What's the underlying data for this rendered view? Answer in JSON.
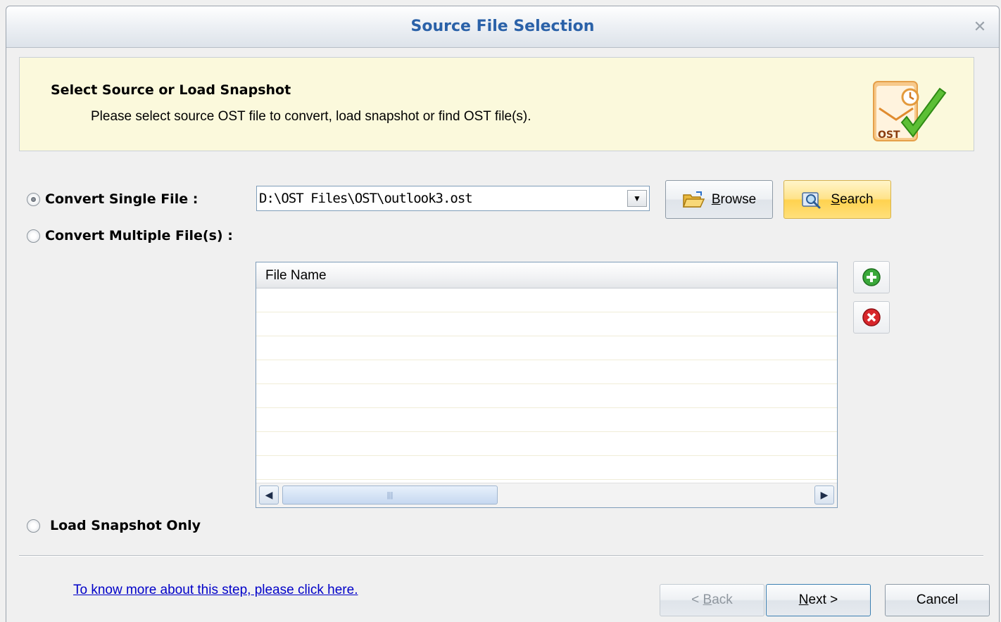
{
  "window": {
    "title": "Source File Selection",
    "close_glyph": "✕"
  },
  "info": {
    "heading": "Select Source or Load Snapshot",
    "description": "Please select source OST file to convert, load snapshot or find OST file(s).",
    "logo_text": "OST"
  },
  "options": {
    "single": {
      "label": "Convert Single File :",
      "checked": true
    },
    "multiple": {
      "label": "Convert Multiple File(s) :",
      "checked": false
    },
    "snapshot": {
      "label": "Load Snapshot Only",
      "checked": false
    }
  },
  "single_file": {
    "path": "D:\\OST Files\\OST\\outlook3.ost",
    "browse": {
      "access_key": "B",
      "rest": "rowse"
    },
    "search": {
      "access_key": "S",
      "rest": "earch"
    }
  },
  "file_list": {
    "column_header": "File Name",
    "rows": []
  },
  "help_link": "To know more about this step, please click here.",
  "footer": {
    "back": {
      "prefix": "< ",
      "access_key": "B",
      "rest": "ack",
      "enabled": false
    },
    "next": {
      "access_key": "N",
      "rest": "ext >"
    },
    "cancel": "Cancel"
  }
}
